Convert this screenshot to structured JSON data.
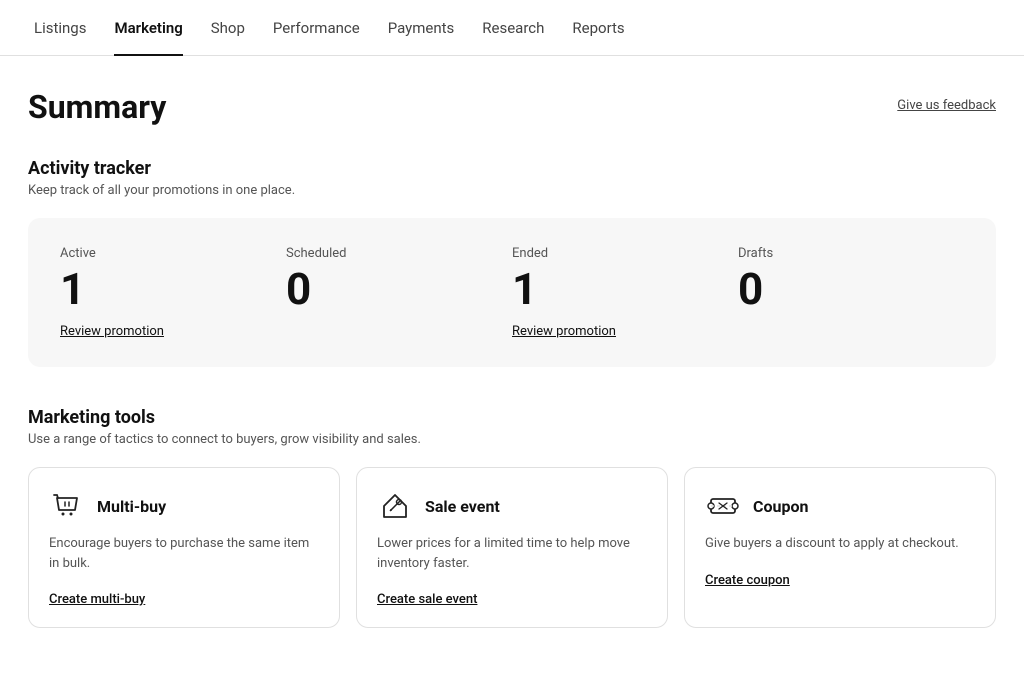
{
  "nav": {
    "items": [
      {
        "id": "listings",
        "label": "Listings",
        "active": false
      },
      {
        "id": "marketing",
        "label": "Marketing",
        "active": true
      },
      {
        "id": "shop",
        "label": "Shop",
        "active": false
      },
      {
        "id": "performance",
        "label": "Performance",
        "active": false
      },
      {
        "id": "payments",
        "label": "Payments",
        "active": false
      },
      {
        "id": "research",
        "label": "Research",
        "active": false
      },
      {
        "id": "reports",
        "label": "Reports",
        "active": false
      }
    ]
  },
  "header": {
    "title": "Summary",
    "feedback_label": "Give us feedback"
  },
  "activity_tracker": {
    "title": "Activity tracker",
    "subtitle": "Keep track of all your promotions in one place.",
    "stats": [
      {
        "id": "active",
        "label": "Active",
        "value": "1",
        "link": "Review promotion"
      },
      {
        "id": "scheduled",
        "label": "Scheduled",
        "value": "0",
        "link": ""
      },
      {
        "id": "ended",
        "label": "Ended",
        "value": "1",
        "link": "Review promotion"
      },
      {
        "id": "drafts",
        "label": "Drafts",
        "value": "0",
        "link": ""
      }
    ]
  },
  "marketing_tools": {
    "title": "Marketing tools",
    "subtitle": "Use a range of tactics to connect to buyers, grow visibility and sales.",
    "tools": [
      {
        "id": "multi-buy",
        "name": "Multi-buy",
        "description": "Encourage buyers to purchase the same item in bulk.",
        "action_label": "Create multi-buy",
        "icon": "multi-buy-icon"
      },
      {
        "id": "sale-event",
        "name": "Sale event",
        "description": "Lower prices for a limited time to help move inventory faster.",
        "action_label": "Create sale event",
        "icon": "sale-event-icon"
      },
      {
        "id": "coupon",
        "name": "Coupon",
        "description": "Give buyers a discount to apply at checkout.",
        "action_label": "Create coupon",
        "icon": "coupon-icon"
      }
    ]
  }
}
